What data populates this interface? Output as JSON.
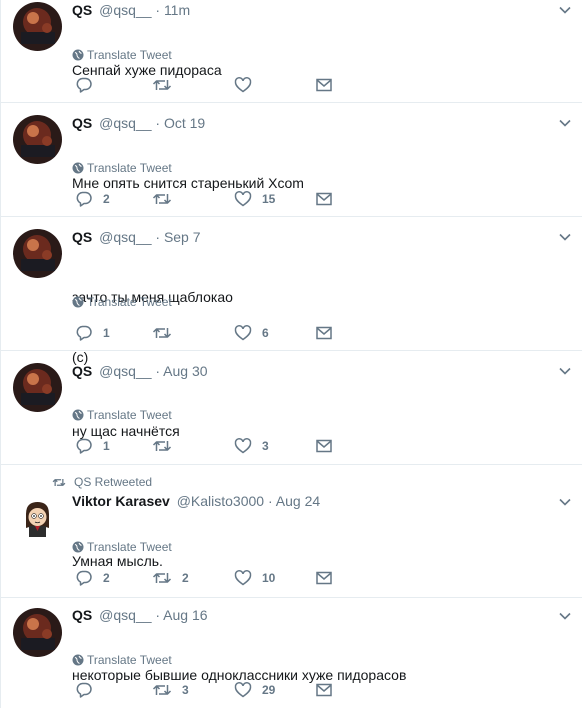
{
  "tweets": [
    {
      "name": "QS",
      "handle": "@qsq__",
      "time": "11m",
      "lines": [
        "Сенпай хуже пидораса"
      ],
      "translate": "Translate Tweet",
      "reply_count": "",
      "retweet_count": "",
      "like_count": "",
      "avatar": "qs-avatar"
    },
    {
      "name": "QS",
      "handle": "@qsq__",
      "time": "Oct 19",
      "lines": [
        "Мне опять снится старенький Xcom"
      ],
      "translate": "Translate Tweet",
      "reply_count": "2",
      "retweet_count": "",
      "like_count": "15",
      "avatar": "qs-avatar"
    },
    {
      "name": "QS",
      "handle": "@qsq__",
      "time": "Sep 7",
      "lines": [
        "зачто ты меня щаблокао",
        "(с)"
      ],
      "translate": "Translate Tweet",
      "reply_count": "1",
      "retweet_count": "",
      "like_count": "6",
      "avatar": "qs-avatar"
    },
    {
      "name": "QS",
      "handle": "@qsq__",
      "time": "Aug 30",
      "lines": [
        "ну щас начнётся"
      ],
      "translate": "Translate Tweet",
      "reply_count": "1",
      "retweet_count": "",
      "like_count": "3",
      "avatar": "qs-avatar"
    },
    {
      "retweeted_by": "QS Retweeted",
      "name": "Viktor Karasev",
      "handle": "@Kalisto3000",
      "time": "Aug 24",
      "lines": [
        "Умная мысль."
      ],
      "translate": "Translate Tweet",
      "reply_count": "2",
      "retweet_count": "2",
      "like_count": "10",
      "avatar": "cartoon-avatar"
    },
    {
      "name": "QS",
      "handle": "@qsq__",
      "time": "Aug 16",
      "lines": [
        "некоторые бывшие одноклассники хуже пидорасов"
      ],
      "translate": "Translate Tweet",
      "reply_count": "",
      "retweet_count": "3",
      "like_count": "29",
      "avatar": "qs-avatar"
    }
  ],
  "colors": {
    "text": "#14171a",
    "muted": "#657786",
    "divider": "#e6ecf0"
  },
  "icons": [
    "reply-icon",
    "retweet-icon",
    "like-icon",
    "message-icon",
    "globe-icon",
    "chevron-down-icon"
  ]
}
